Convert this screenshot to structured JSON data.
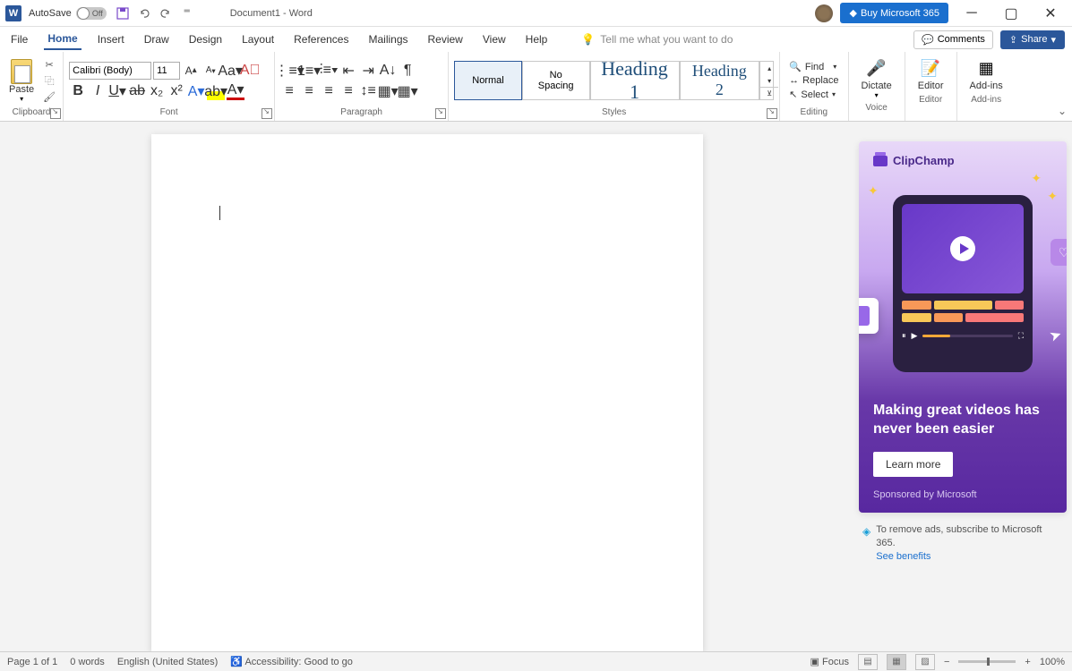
{
  "titlebar": {
    "autosave_label": "AutoSave",
    "autosave_state": "Off",
    "doc_title": "Document1  -  Word",
    "buy_label": "Buy Microsoft 365"
  },
  "tabs": {
    "file": "File",
    "home": "Home",
    "insert": "Insert",
    "draw": "Draw",
    "design": "Design",
    "layout": "Layout",
    "references": "References",
    "mailings": "Mailings",
    "review": "Review",
    "view": "View",
    "help": "Help",
    "tell_me": "Tell me what you want to do",
    "comments": "Comments",
    "share": "Share"
  },
  "ribbon": {
    "clipboard": {
      "paste": "Paste",
      "label": "Clipboard"
    },
    "font": {
      "name": "Calibri (Body)",
      "size": "11",
      "label": "Font"
    },
    "paragraph": {
      "label": "Paragraph"
    },
    "styles": {
      "normal": "Normal",
      "nospacing": "No Spacing",
      "heading1": "Heading 1",
      "heading2": "Heading 2",
      "label": "Styles"
    },
    "editing": {
      "find": "Find",
      "replace": "Replace",
      "select": "Select",
      "label": "Editing"
    },
    "voice": {
      "dictate": "Dictate",
      "label": "Voice"
    },
    "editor": {
      "editor": "Editor",
      "label": "Editor"
    },
    "addins": {
      "addins": "Add-ins",
      "label": "Add-ins"
    }
  },
  "ad": {
    "brand": "ClipChamp",
    "headline": "Making great videos has never been easier",
    "cta": "Learn more",
    "sponsor": "Sponsored by Microsoft",
    "remove_text": "To remove ads, subscribe to Microsoft 365.",
    "benefits_link": "See benefits"
  },
  "statusbar": {
    "page": "Page 1 of 1",
    "words": "0 words",
    "lang": "English (United States)",
    "accessibility": "Accessibility: Good to go",
    "focus": "Focus",
    "zoom": "100%"
  }
}
